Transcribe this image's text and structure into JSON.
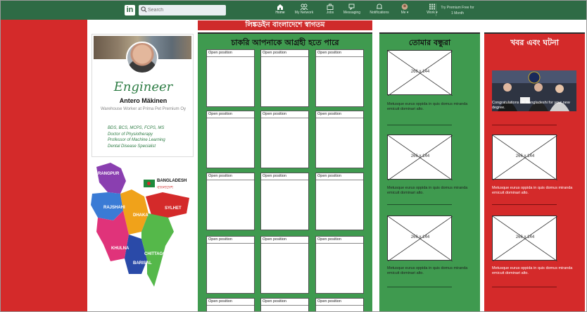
{
  "nav": {
    "logo": "in",
    "search_placeholder": "Search",
    "items": [
      {
        "label": "Home",
        "icon": "home-icon"
      },
      {
        "label": "My Network",
        "icon": "network-icon"
      },
      {
        "label": "Jobs",
        "icon": "briefcase-icon"
      },
      {
        "label": "Messaging",
        "icon": "messaging-icon"
      },
      {
        "label": "Notifications",
        "icon": "bell-icon"
      },
      {
        "label": "Me ▾",
        "icon": "avatar-icon"
      },
      {
        "label": "Work ▾",
        "icon": "grid-icon"
      }
    ],
    "premium_line1": "Try Premium Free for",
    "premium_line2": "1 Month"
  },
  "banner": "লিঙ্কডইন বাংলাদেশে স্বাগতম",
  "profile": {
    "title": "Engineer",
    "name": "Antero Mäkinen",
    "role": "Warehouse Worker at Prima Pet Premium Oy",
    "credentials": [
      "BDS, BCS, MCPS, FCPS, MS",
      "Doctor of Physiotherapy",
      "Professor of Machine Learning",
      "Dental Disease Specialist"
    ]
  },
  "map": {
    "country": "BANGLADESH",
    "country_bn": "বাংলাদেশ",
    "divisions": [
      {
        "name": "RANGPUR",
        "color": "#8a3fb0"
      },
      {
        "name": "RAJSHAHI",
        "color": "#3a7bd5"
      },
      {
        "name": "DHAKA",
        "color": "#f0a21a"
      },
      {
        "name": "SYLHET",
        "color": "#d42a2a"
      },
      {
        "name": "KHULNA",
        "color": "#e0337a"
      },
      {
        "name": "BARISAL",
        "color": "#2a4aa8"
      },
      {
        "name": "CHITTAGONG",
        "color": "#55b84a"
      }
    ]
  },
  "jobs": {
    "title": "চাকরি আপনাকে আগ্রহী হতে পারে",
    "card_label": "Open position",
    "rows": 5,
    "cols": 3
  },
  "friends": {
    "title": "তোমার বন্ধুরা",
    "placeholder": "266 x 144",
    "captions": [
      "Metusque eurus oppida in quis domus miranda emicuit dominari alto.",
      "Metusque eurus oppida in quis domus miranda emicuit dominari alto.",
      "Metusque eurus oppida in quis domus miranda emicuit dominari alto."
    ]
  },
  "news": {
    "title": "খবর এবং ঘটনা",
    "placeholder": "266 x 144",
    "captions": [
      "Congratulations Dr. Bangladeshi for your new degree.",
      "Metusque eurus oppida in quis domus miranda emicuit dominari alto.",
      "Metusque eurus oppida in quis domus miranda emicuit dominari alto."
    ]
  },
  "colors": {
    "nav": "#2e6b45",
    "green": "#3f9a4f",
    "red": "#d42a2a"
  }
}
